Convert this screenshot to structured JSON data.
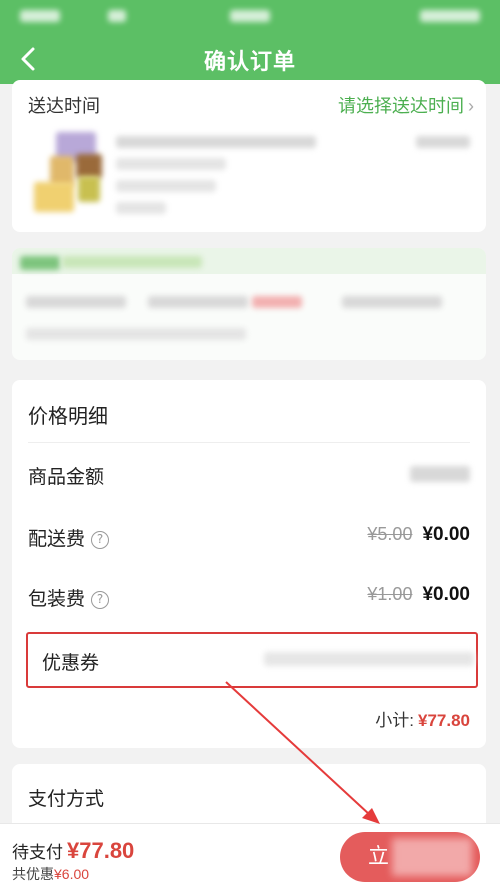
{
  "header": {
    "title": "确认订单",
    "back_icon": "chevron-left-icon",
    "color": "#5cbf65"
  },
  "delivery": {
    "label": "送达时间",
    "select_text": "请选择送达时间",
    "chevron": "›"
  },
  "price_detail": {
    "title": "价格明细",
    "items": [
      {
        "label": "商品金额"
      },
      {
        "label": "配送费",
        "help_icon": "question-circle-icon",
        "help_glyph": "?",
        "original": "¥5.00",
        "amount": "¥0.00"
      },
      {
        "label": "包装费",
        "help_icon": "question-circle-icon",
        "help_glyph": "?",
        "original": "¥1.00",
        "amount": "¥0.00"
      }
    ],
    "coupon_label": "优惠券",
    "subtotal_label": "小计:",
    "subtotal_value": "¥77.80"
  },
  "payment": {
    "label": "支付方式"
  },
  "footer": {
    "pay_label": "待支付",
    "pay_value": "¥77.80",
    "saved_label": "共优惠",
    "saved_value": "¥6.00",
    "submit_label": "立"
  },
  "colors": {
    "accent_green": "#5cbf65",
    "price_red": "#d9453d",
    "highlight_red": "#d93a3a",
    "button_red": "#e45c5c"
  }
}
